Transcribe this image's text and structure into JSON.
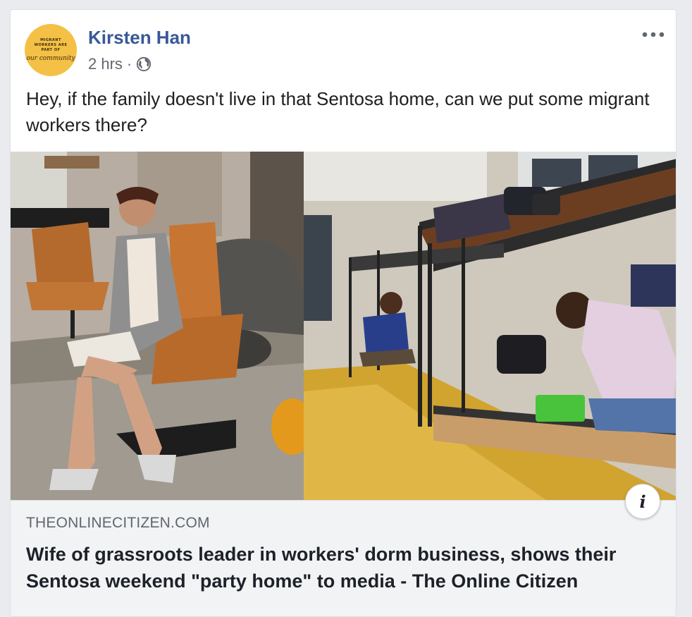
{
  "post": {
    "author": "Kirsten Han",
    "timestamp": "2 hrs",
    "separator": "·",
    "audience_icon": "globe-icon",
    "more_icon": "more-options-icon",
    "text": "Hey, if the family doesn't live in that Sentosa home, can we put some migrant workers there?"
  },
  "avatar": {
    "line1": "MIGRANT WORKERS ARE PART OF",
    "line2": "our community"
  },
  "link_preview": {
    "domain": "THEONLINECITIZEN.COM",
    "headline": "Wife of grassroots leader in workers' dorm business, shows their Sentosa weekend \"party home\" to media - The Online Citizen",
    "info_label": "i"
  },
  "colors": {
    "author": "#385898",
    "avatar_bg": "#f4c146",
    "link_bg": "#f2f3f5"
  }
}
